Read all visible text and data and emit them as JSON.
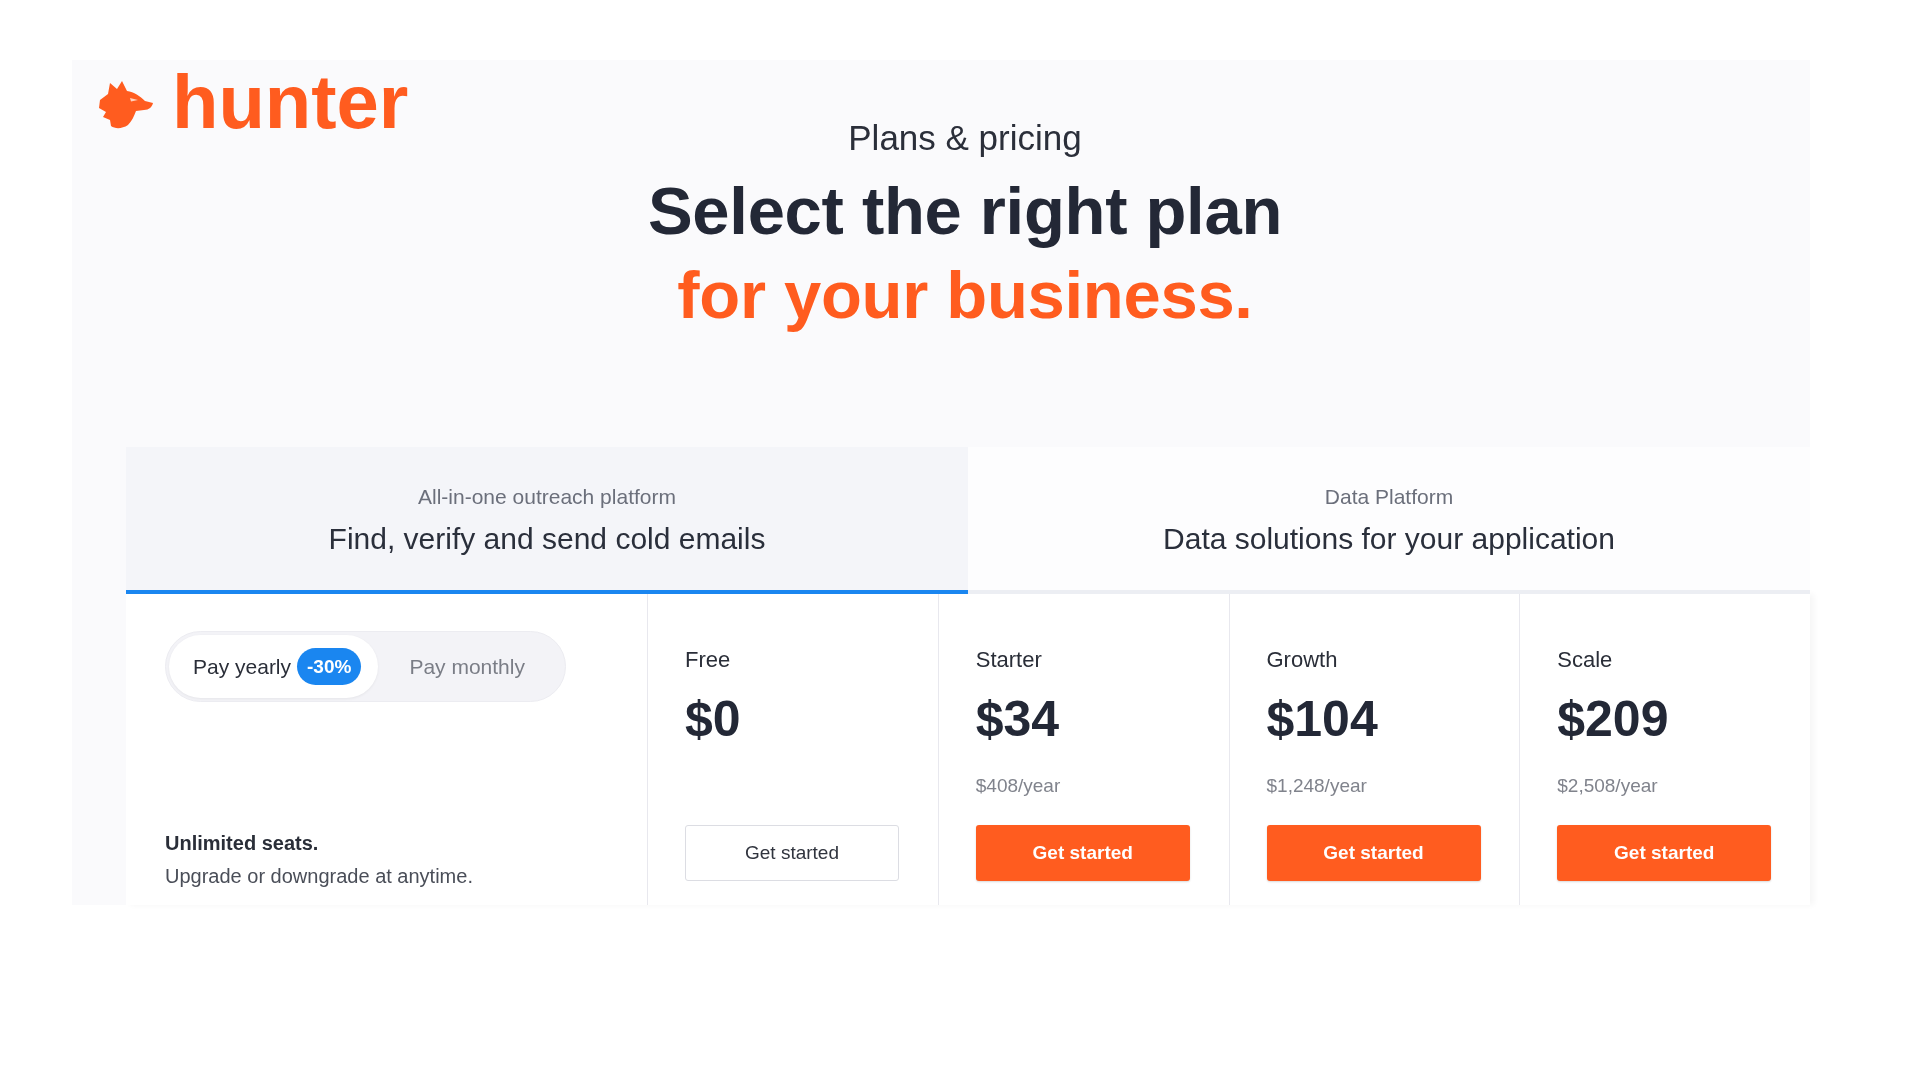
{
  "logo": {
    "wordmark": "hunter"
  },
  "header": {
    "eyebrow": "Plans & pricing",
    "title": "Select the right plan",
    "title_accent": "for your business."
  },
  "tabs": [
    {
      "label": "All-in-one outreach platform",
      "title": "Find, verify and send cold emails",
      "selected": true
    },
    {
      "label": "Data Platform",
      "title": "Data solutions for your application",
      "selected": false
    }
  ],
  "billing_toggle": {
    "options": [
      {
        "label": "Pay yearly",
        "badge": "-30%",
        "selected": true
      },
      {
        "label": "Pay monthly",
        "selected": false
      }
    ]
  },
  "seats_note": {
    "heading": "Unlimited seats.",
    "text": "Upgrade or downgrade at anytime."
  },
  "plans": [
    {
      "name": "Free",
      "price": "$0",
      "button": {
        "label": "Get started",
        "kind": "outline"
      }
    },
    {
      "name": "Starter",
      "price": "$34",
      "yearly_total": "$408/year",
      "button": {
        "label": "Get started",
        "kind": "primary"
      }
    },
    {
      "name": "Growth",
      "price": "$104",
      "yearly_total": "$1,248/year",
      "button": {
        "label": "Get started",
        "kind": "primary"
      }
    },
    {
      "name": "Scale",
      "price": "$209",
      "yearly_total": "$2,508/year",
      "button": {
        "label": "Get started",
        "kind": "primary"
      }
    }
  ]
}
